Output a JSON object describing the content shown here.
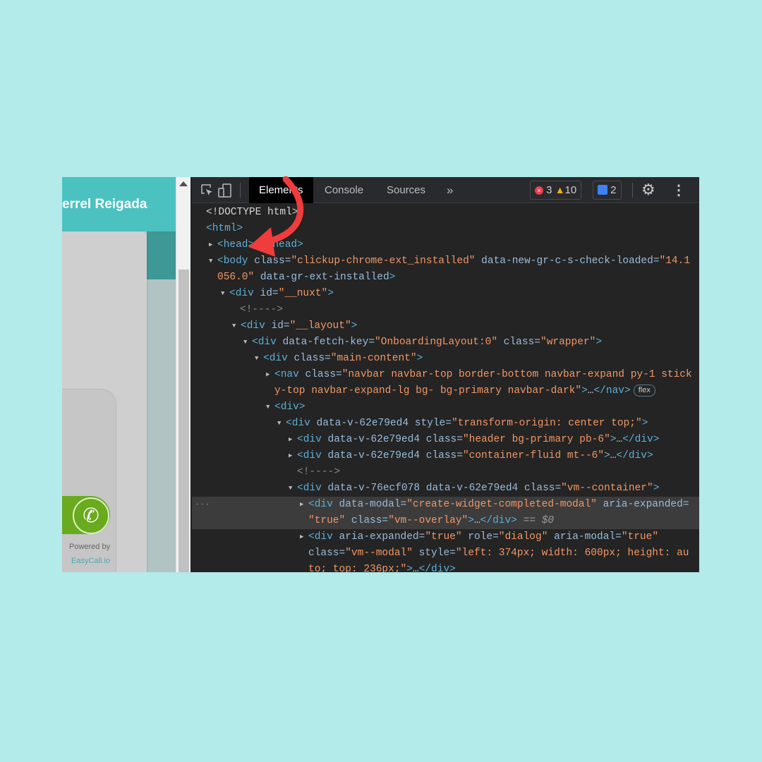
{
  "page_preview": {
    "header_name": "errel Reigada",
    "call_button_icon": "phone-icon",
    "powered_by": "Powered by",
    "brand": "EasyCall.io",
    "colors": {
      "header": "#4bc2c0",
      "call_button": "#6aaa1e"
    }
  },
  "devtools": {
    "toolbar": {
      "inspect_icon": "inspect-element-icon",
      "device_icon": "device-toolbar-icon",
      "tabs": [
        {
          "label": "Elements",
          "active": true
        },
        {
          "label": "Console",
          "active": false
        },
        {
          "label": "Sources",
          "active": false
        }
      ],
      "more_tabs": "»",
      "errors": "3",
      "warnings": "10",
      "messages": "2",
      "settings_icon": "gear-icon",
      "menu_icon": "kebab-menu-icon"
    },
    "lines": [
      {
        "toggle": "",
        "tokens": [
          [
            "dt",
            "<!DOCTYPE html>"
          ]
        ]
      },
      {
        "toggle": "",
        "tokens": [
          [
            "tag",
            "<html>"
          ]
        ]
      },
      {
        "toggle": "collapsed",
        "tokens": [
          [
            "tag",
            "<head>…</head>"
          ]
        ]
      },
      {
        "toggle": "expanded",
        "tokens": [
          [
            "tag",
            "<body "
          ],
          [
            "an",
            "class="
          ],
          [
            "av",
            "\"clickup-chrome-ext_installed\""
          ],
          [
            "an",
            " data-new-gr-c-s-check-loaded="
          ],
          [
            "av",
            "\"14.1"
          ]
        ]
      },
      {
        "toggle": "",
        "tokens": [
          [
            "av",
            "056.0\""
          ],
          [
            "an",
            " data-gr-ext-installed"
          ],
          [
            "tag",
            ">"
          ]
        ]
      },
      {
        "toggle": "expanded",
        "tokens": [
          [
            "tag",
            "<div "
          ],
          [
            "an",
            "id="
          ],
          [
            "av",
            "\"__nuxt\""
          ],
          [
            "tag",
            ">"
          ]
        ]
      },
      {
        "toggle": "",
        "tokens": [
          [
            "cm",
            "<!---->"
          ]
        ]
      },
      {
        "toggle": "expanded",
        "tokens": [
          [
            "tag",
            "<div "
          ],
          [
            "an",
            "id="
          ],
          [
            "av",
            "\"__layout\""
          ],
          [
            "tag",
            ">"
          ]
        ]
      },
      {
        "toggle": "expanded",
        "tokens": [
          [
            "tag",
            "<div "
          ],
          [
            "an",
            "data-fetch-key="
          ],
          [
            "av",
            "\"OnboardingLayout:0\""
          ],
          [
            "an",
            " class="
          ],
          [
            "av",
            "\"wrapper\""
          ],
          [
            "tag",
            ">"
          ]
        ]
      },
      {
        "toggle": "expanded",
        "tokens": [
          [
            "tag",
            "<div "
          ],
          [
            "an",
            "class="
          ],
          [
            "av",
            "\"main-content\""
          ],
          [
            "tag",
            ">"
          ]
        ]
      },
      {
        "toggle": "collapsed",
        "tokens": [
          [
            "tag",
            "<nav "
          ],
          [
            "an",
            "class="
          ],
          [
            "av",
            "\"navbar navbar-top border-bottom navbar-expand py-1 stick"
          ]
        ]
      },
      {
        "toggle": "",
        "tokens": [
          [
            "av",
            "y-top navbar-expand-lg bg- bg-primary navbar-dark\""
          ],
          [
            "tag",
            ">"
          ],
          [
            "pl",
            "…"
          ],
          [
            "tag",
            "</nav>"
          ]
        ],
        "badge": "flex"
      },
      {
        "toggle": "expanded",
        "tokens": [
          [
            "tag",
            "<div>"
          ]
        ]
      },
      {
        "toggle": "expanded",
        "tokens": [
          [
            "tag",
            "<div "
          ],
          [
            "an",
            "data-v-62e79ed4 style="
          ],
          [
            "av",
            "\"transform-origin: center top;\""
          ],
          [
            "tag",
            ">"
          ]
        ]
      },
      {
        "toggle": "collapsed",
        "tokens": [
          [
            "tag",
            "<div "
          ],
          [
            "an",
            "data-v-62e79ed4 class="
          ],
          [
            "av",
            "\"header bg-primary pb-6\""
          ],
          [
            "tag",
            ">"
          ],
          [
            "pl",
            "…"
          ],
          [
            "tag",
            "</div>"
          ]
        ]
      },
      {
        "toggle": "collapsed",
        "tokens": [
          [
            "tag",
            "<div "
          ],
          [
            "an",
            "data-v-62e79ed4 class="
          ],
          [
            "av",
            "\"container-fluid mt--6\""
          ],
          [
            "tag",
            ">"
          ],
          [
            "pl",
            "…"
          ],
          [
            "tag",
            "</div>"
          ]
        ]
      },
      {
        "toggle": "",
        "tokens": [
          [
            "cm",
            "<!---->"
          ]
        ]
      },
      {
        "toggle": "expanded",
        "tokens": [
          [
            "tag",
            "<div "
          ],
          [
            "an",
            "data-v-76ecf078 data-v-62e79ed4 class="
          ],
          [
            "av",
            "\"vm--container\""
          ],
          [
            "tag",
            ">"
          ]
        ]
      },
      {
        "toggle": "collapsed",
        "selected": true,
        "tokens": [
          [
            "tag",
            "<div "
          ],
          [
            "an",
            "data-modal="
          ],
          [
            "av",
            "\"create-widget-completed-modal\""
          ],
          [
            "an",
            " aria-expanded="
          ]
        ]
      },
      {
        "toggle": "",
        "selected": true,
        "tokens": [
          [
            "av",
            "\"true\""
          ],
          [
            "an",
            " class="
          ],
          [
            "av",
            "\"vm--overlay\""
          ],
          [
            "tag",
            ">"
          ],
          [
            "pl",
            "…"
          ],
          [
            "tag",
            "</div>"
          ],
          [
            "eq",
            " == $0"
          ]
        ]
      },
      {
        "toggle": "collapsed",
        "tokens": [
          [
            "tag",
            "<div "
          ],
          [
            "an",
            "aria-expanded="
          ],
          [
            "av",
            "\"true\""
          ],
          [
            "an",
            " role="
          ],
          [
            "av",
            "\"dialog\""
          ],
          [
            "an",
            " aria-modal="
          ],
          [
            "av",
            "\"true\""
          ]
        ]
      },
      {
        "toggle": "",
        "tokens": [
          [
            "an",
            "class="
          ],
          [
            "av",
            "\"vm--modal\""
          ],
          [
            "an",
            " style="
          ],
          [
            "av",
            "\"left: 374px; width: 600px; height: au"
          ]
        ]
      },
      {
        "toggle": "",
        "tokens": [
          [
            "av",
            "to; top: 236px;\""
          ],
          [
            "tag",
            ">"
          ],
          [
            "pl",
            "…"
          ],
          [
            "tag",
            "</div>"
          ]
        ]
      }
    ]
  },
  "annotation": {
    "arrow_color": "#f03c3c",
    "arrow_icon": "curved-arrow-icon"
  }
}
